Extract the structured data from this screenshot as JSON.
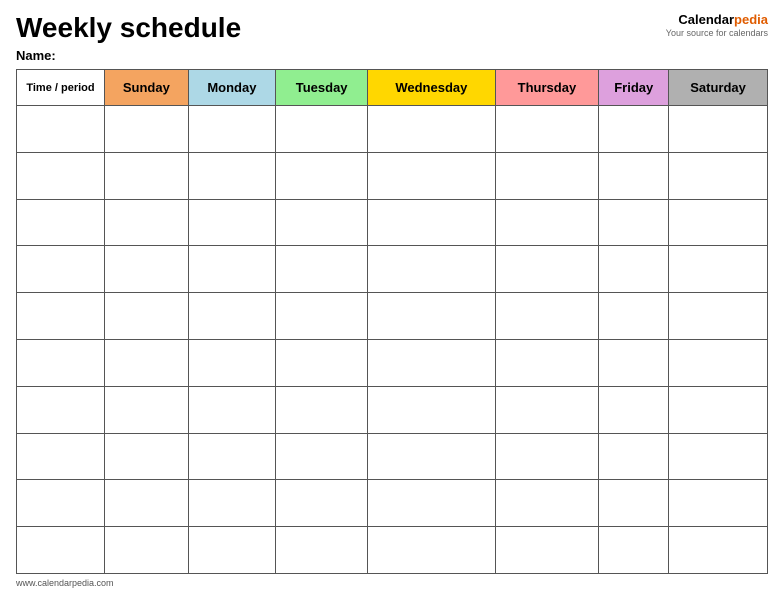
{
  "header": {
    "title": "Weekly schedule",
    "logo": {
      "calendar": "Calendar",
      "pedia": "pedia",
      "sub": "Your source for calendars"
    },
    "name_label": "Name:"
  },
  "table": {
    "time_period_label": "Time / period",
    "days": [
      {
        "label": "Sunday",
        "color": "#f4a460",
        "class": "col-sunday"
      },
      {
        "label": "Monday",
        "color": "#add8e6",
        "class": "col-monday"
      },
      {
        "label": "Tuesday",
        "color": "#90ee90",
        "class": "col-tuesday"
      },
      {
        "label": "Wednesday",
        "color": "#ffd700",
        "class": "col-wednesday"
      },
      {
        "label": "Thursday",
        "color": "#ff9999",
        "class": "col-thursday"
      },
      {
        "label": "Friday",
        "color": "#dda0dd",
        "class": "col-friday"
      },
      {
        "label": "Saturday",
        "color": "#b0b0b0",
        "class": "col-saturday"
      }
    ],
    "rows": 10
  },
  "footer": {
    "url": "www.calendarpedia.com"
  }
}
